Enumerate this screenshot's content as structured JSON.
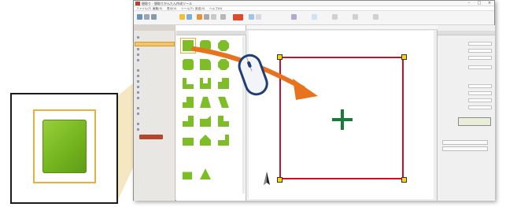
{
  "app": {
    "title": "間取り - 間取りかんたん作成ツール",
    "menu": [
      "ファイル(F)",
      "編集(E)",
      "表示(V)",
      "ツール(T)",
      "設定(S)",
      "ヘルプ(H)"
    ],
    "window_controls": [
      "minimize",
      "maximize",
      "close"
    ]
  },
  "toolbar": {
    "icons": [
      "new-icon",
      "open-icon",
      "save-icon",
      "undo-icon",
      "redo-icon",
      "zoom-icon",
      "grid-icon",
      "print-icon",
      "highlight-tool",
      "select-icon",
      "line-icon",
      "text-icon"
    ]
  },
  "left_nav": {
    "icons": [
      "room-icon",
      "door-icon",
      "window-icon",
      "furniture-icon",
      "stairs-icon",
      "equipment-icon",
      "exterior-icon",
      "text-tool-icon",
      "dimension-icon",
      "layer-icon"
    ]
  },
  "shape_panel": {
    "shapes": [
      "square",
      "rounded-octagon",
      "octagon",
      "rounded-square",
      "rounded-corner",
      "circle",
      "l-shape",
      "u-shape",
      "step-shape",
      "parallelogram",
      "trapezoid",
      "parallelogram-right",
      "step-left",
      "step-mid",
      "step-right",
      "l-shape-small",
      "notch",
      "l-right",
      "small-square",
      "triangle"
    ]
  },
  "canvas": {
    "selection_color": "#c8102e",
    "handle_color": "#ffd400",
    "center_mark_color": "#1a7a3a"
  },
  "zoom_inset": {
    "tile_color": "#7dbe26",
    "frame_color": "#e8b03c"
  },
  "overlay": {
    "arrow_color": "#e8731f"
  }
}
